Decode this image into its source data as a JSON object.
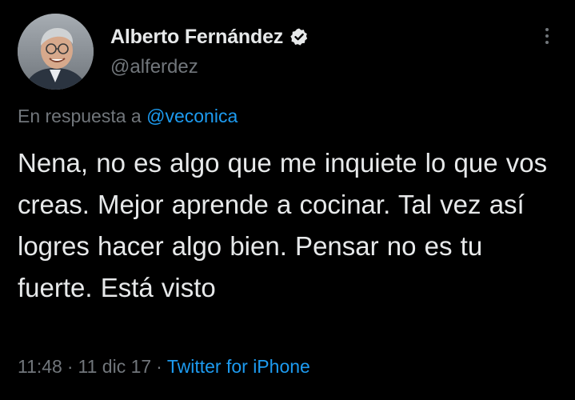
{
  "author": {
    "display_name": "Alberto Fernández",
    "handle": "@alferdez",
    "verified_icon": "verified-badge-icon",
    "avatar_icon": "profile-photo"
  },
  "reply": {
    "prefix": "En respuesta a",
    "mention": "@veconica"
  },
  "tweet": {
    "text": "Nena, no es algo que me inquiete lo que vos creas. Mejor aprende a cocinar. Tal vez así logres hacer algo bien. Pensar no es tu fuerte. Está visto"
  },
  "meta": {
    "time": "11:48",
    "date": "11 dic 17",
    "separator": "·",
    "source": "Twitter for iPhone"
  },
  "more_icon": "more-options-icon",
  "colors": {
    "background": "#000000",
    "primary_text": "#e7e9ea",
    "secondary_text": "#71767b",
    "accent": "#1d9bf0"
  }
}
